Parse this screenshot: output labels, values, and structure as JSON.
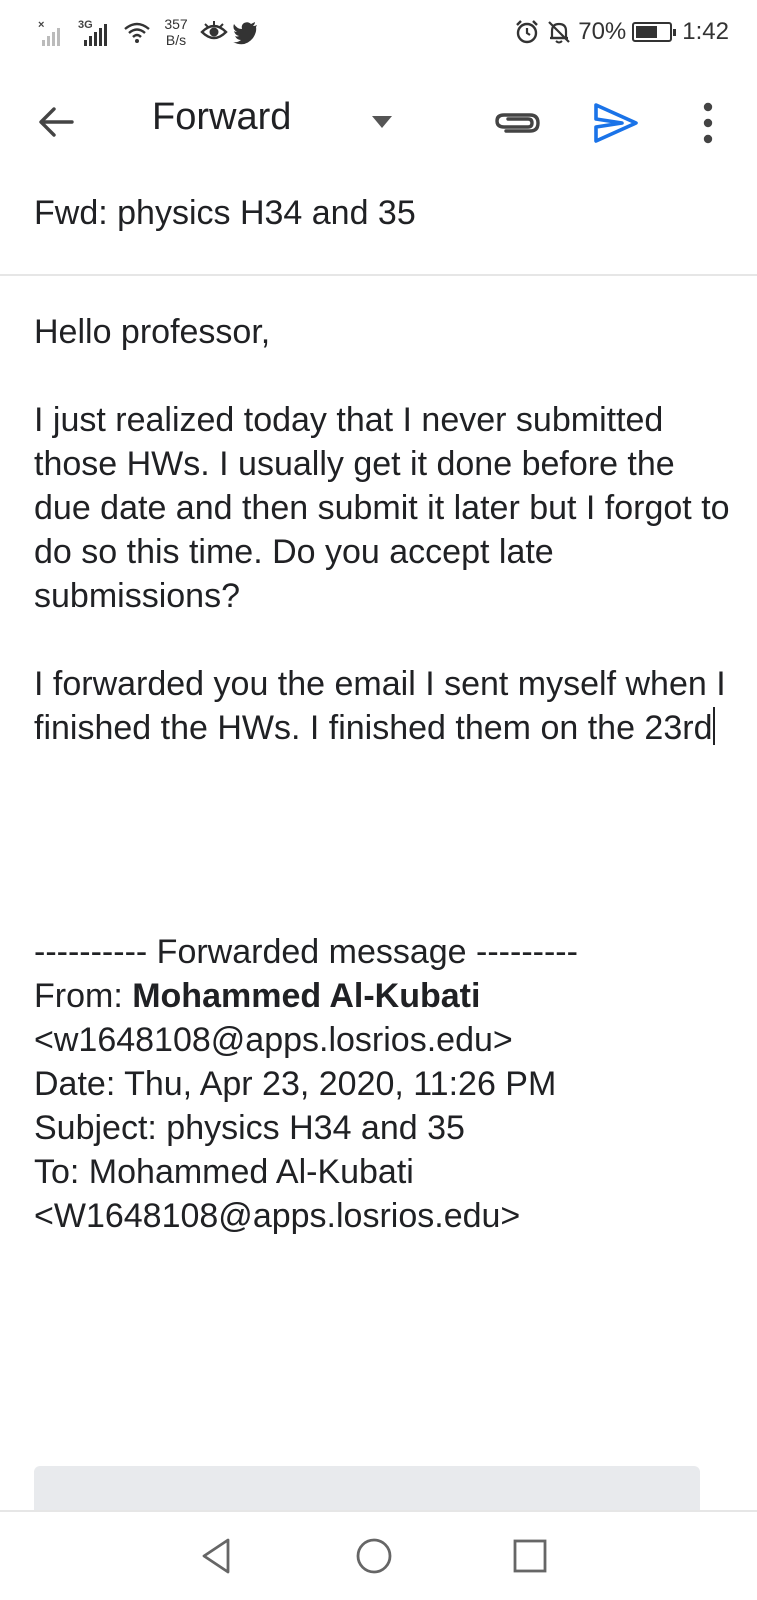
{
  "status_bar": {
    "network_tag": "3G",
    "speed_value": "357",
    "speed_unit": "B/s",
    "battery_percent": "70%",
    "battery_level": 0.7,
    "time": "1:42",
    "icons": [
      "no-signal-icon",
      "signal-icon",
      "wifi-icon",
      "eye-icon",
      "twitter-icon",
      "alarm-icon",
      "notifications-off-icon",
      "battery-icon"
    ]
  },
  "toolbar": {
    "title": "Forward",
    "icons": [
      "back-arrow-icon",
      "dropdown-arrow-icon",
      "attach-icon",
      "send-icon",
      "more-vert-icon"
    ],
    "send_color": "#1a73e8"
  },
  "subject": "Fwd: physics H34 and 35",
  "body": {
    "greeting": "Hello professor,",
    "paragraph1": "I just realized today that I never submitted those HWs. I usually get it done before the due date and then submit it later but I forgot to do so this time. Do you accept late submissions?",
    "paragraph2": "I forwarded you the email I sent myself when I finished the HWs. I finished them on the 23rd"
  },
  "forwarded": {
    "header": "---------- Forwarded message ---------",
    "from_label": "From: ",
    "from_name": "Mohammed Al-Kubati",
    "from_email": "<w1648108@apps.losrios.edu>",
    "date": "Date: Thu, Apr 23, 2020, 11:26 PM",
    "subject": "Subject: physics H34 and 35",
    "to": "To: Mohammed Al-Kubati",
    "to_email": "<W1648108@apps.losrios.edu>"
  },
  "nav_bar": {
    "icons": [
      "back-triangle-icon",
      "home-circle-icon",
      "recents-square-icon"
    ]
  }
}
